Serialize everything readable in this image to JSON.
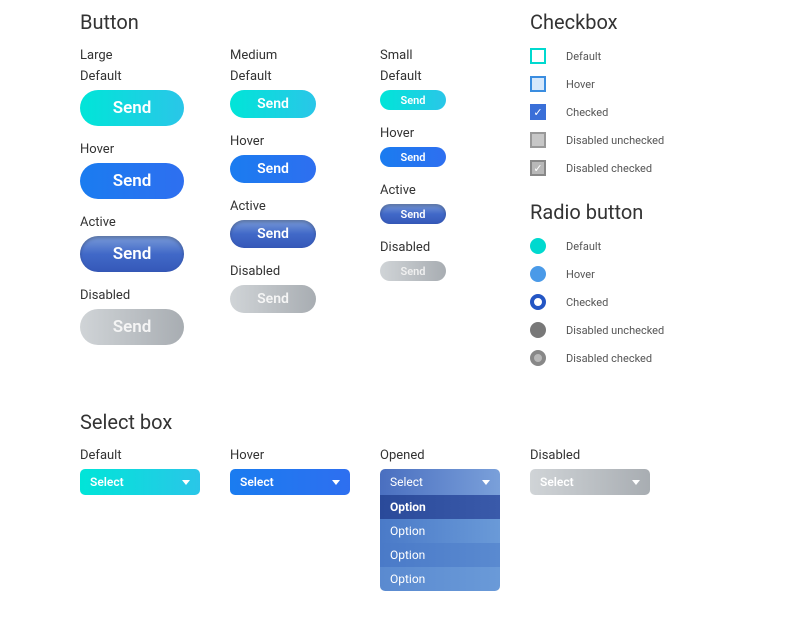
{
  "buttons": {
    "title": "Button",
    "sizes": {
      "large": "Large",
      "medium": "Medium",
      "small": "Small"
    },
    "states": {
      "default": "Default",
      "hover": "Hover",
      "active": "Active",
      "disabled": "Disabled"
    },
    "label": "Send"
  },
  "checkbox": {
    "title": "Checkbox",
    "states": {
      "default": "Default",
      "hover": "Hover",
      "checked": "Checked",
      "disabled_unchecked": "Disabled unchecked",
      "disabled_checked": "Disabled checked"
    }
  },
  "radio": {
    "title": "Radio button",
    "states": {
      "default": "Default",
      "hover": "Hover",
      "checked": "Checked",
      "disabled_unchecked": "Disabled unchecked",
      "disabled_checked": "Disabled checked"
    }
  },
  "select": {
    "title": "Select box",
    "states": {
      "default": "Default",
      "hover": "Hover",
      "opened": "Opened",
      "disabled": "Disabled"
    },
    "label": "Select",
    "options": [
      "Option",
      "Option",
      "Option",
      "Option"
    ]
  }
}
